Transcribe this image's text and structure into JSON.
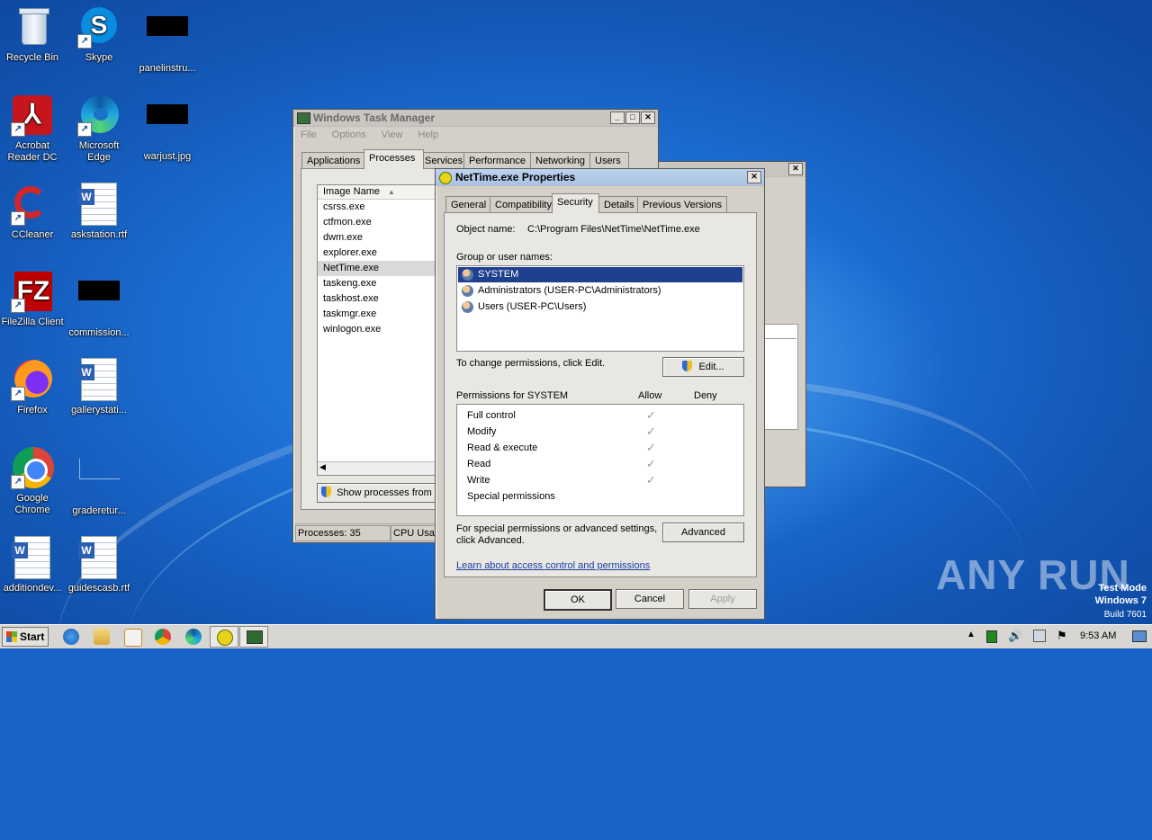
{
  "desktop": {
    "icons": [
      {
        "label": "Recycle Bin"
      },
      {
        "label": "Skype"
      },
      {
        "label": "panelinstru..."
      },
      {
        "label": "Acrobat Reader DC"
      },
      {
        "label": "Microsoft Edge"
      },
      {
        "label": "warjust.jpg"
      },
      {
        "label": "CCleaner"
      },
      {
        "label": "askstation.rtf"
      },
      {
        "label": "FileZilla Client"
      },
      {
        "label": "commission..."
      },
      {
        "label": "Firefox"
      },
      {
        "label": "gallerystati..."
      },
      {
        "label": "Google Chrome"
      },
      {
        "label": "graderetur..."
      },
      {
        "label": "additiondev..."
      },
      {
        "label": "guidescasb.rtf"
      }
    ],
    "watermark": {
      "brand": "ANY RUN",
      "test_mode": "Test Mode",
      "os": "Windows 7",
      "build": "Build 7601"
    }
  },
  "task_manager": {
    "title": "Windows Task Manager",
    "menu": [
      "File",
      "Options",
      "View",
      "Help"
    ],
    "tabs": [
      "Applications",
      "Processes",
      "Services",
      "Performance",
      "Networking",
      "Users"
    ],
    "selected_tab": "Processes",
    "column_header": "Image Name",
    "processes": [
      "csrss.exe",
      "ctfmon.exe",
      "dwm.exe",
      "explorer.exe",
      "NetTime.exe",
      "taskeng.exe",
      "taskhost.exe",
      "taskmgr.exe",
      "winlogon.exe"
    ],
    "selected_process": "NetTime.exe",
    "show_processes_label": "Show processes from",
    "status_processes": "Processes: 35",
    "status_cpu": "CPU Usag"
  },
  "properties": {
    "title": "NetTime.exe Properties",
    "tabs": [
      "General",
      "Compatibility",
      "Security",
      "Details",
      "Previous Versions"
    ],
    "selected_tab": "Security",
    "object_name_label": "Object name:",
    "object_name_value": "C:\\Program Files\\NetTime\\NetTime.exe",
    "group_label": "Group or user names:",
    "users": [
      "SYSTEM",
      "Administrators (USER-PC\\Administrators)",
      "Users (USER-PC\\Users)"
    ],
    "selected_user": "SYSTEM",
    "change_text": "To change permissions, click Edit.",
    "edit_button": "Edit...",
    "permissions_for": "Permissions for SYSTEM",
    "allow_header": "Allow",
    "deny_header": "Deny",
    "permissions": [
      {
        "name": "Full control",
        "allow": true
      },
      {
        "name": "Modify",
        "allow": true
      },
      {
        "name": "Read & execute",
        "allow": true
      },
      {
        "name": "Read",
        "allow": true
      },
      {
        "name": "Write",
        "allow": true
      },
      {
        "name": "Special permissions",
        "allow": false
      }
    ],
    "special_text_1": "For special permissions or advanced settings,",
    "special_text_2": "click Advanced.",
    "advanced_button": "Advanced",
    "learn_link": "Learn about access control and permissions",
    "ok_button": "OK",
    "cancel_button": "Cancel",
    "apply_button": "Apply"
  },
  "taskbar": {
    "start_label": "Start",
    "clock": "9:53 AM"
  }
}
